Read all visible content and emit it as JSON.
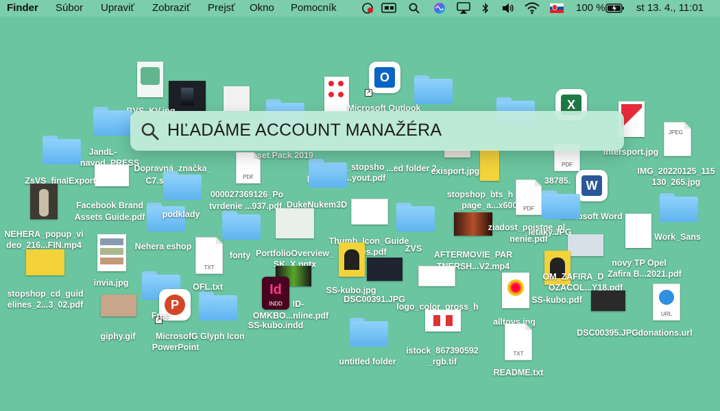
{
  "menubar": {
    "app": "Finder",
    "menus": [
      "Súbor",
      "Upraviť",
      "Zobraziť",
      "Prejsť",
      "Okno",
      "Pomocník"
    ],
    "battery": "100 %",
    "datetime": "st 13. 4.,  11:01",
    "tray_icons": [
      "record-icon",
      "display-icon",
      "search-icon",
      "siri-icon",
      "airplay-icon",
      "bluetooth-icon",
      "volume-icon",
      "wifi-icon",
      "flag-sk-icon",
      "battery-icon"
    ]
  },
  "spotlight": {
    "query": "HĽADÁME ACCOUNT MANAŽÉRA"
  },
  "desktop": {
    "labels": {
      "bvs": "BVS_KV.jpg",
      "outlook": "Microsoft Outlook",
      "jandl": "JandL-",
      "navod": "navod_PRESS",
      "set_pack": "set Pack 2019",
      "zsvs": "ZsVS_finalExport",
      "dopravna1": "Dopravná_značka_",
      "dopravna2": "C7.svg.png",
      "stopshop1_a": "20171205_stopsho",
      "stopshop1_b": "p_cd_gui...yout.pdf",
      "untitled2": "...ed folder 2",
      "intersport": "intersport.jpg",
      "exisport": "exisport.jpg",
      "img_a": "IMG_20220125_115",
      "img_b": "130_265.jpg",
      "po_a": "000027369126_Po",
      "po_b": "tvrdenie ...937.pdf",
      "n38785": "38785.",
      "bts_a": "stopshop_bts_h",
      "bts_b": "_page_a...x600.",
      "fb_a": "Facebook Brand",
      "fb_b": "Assets Guide.pdf",
      "podklady": "podklady",
      "duke": "DukeNukem3D",
      "word": "Microsoft Word",
      "letaky": "letaky.JPG",
      "worksans": "Work_Sans",
      "nehera_a": "NEHERA_popup_vi",
      "nehera_b": "deo_216...FIN.mp4",
      "ziadost_a": "ziadost_poistne_pl",
      "ziadost_b": "nenie.pdf",
      "thumb_a": "Thumb_Icon_Guide",
      "thumb_b": "lines.pdf",
      "nehera_eshop": "Nehera eshop",
      "fonty": "fonty",
      "portfolio_a": "PortfolioOverview_",
      "portfolio_b": "SK_X.pptx",
      "zvs": "ZVS",
      "after_a": "AFTERMOVIE_PAR",
      "after_b": "TNERSH...V2.mp4",
      "opel_a": "novy TP Opel",
      "opel_b": "Zafira B...2021.pdf",
      "invia": "invia.jpg",
      "ofl": "OFL.txt",
      "sskubo_jpg": "SS-kubo.jpg",
      "zafira_a": "OM_ZAFIRA_D",
      "zafira_b": "OZACOL...Y18.pdf",
      "sskubo_pdf": "SS-kubo.pdf",
      "guide_a": "stopshop_cd_guid",
      "guide_b": "elines_2...3_02.pdf",
      "dsc391": "DSC00391.JPG",
      "omkbo_a": "ID-",
      "omkbo_b": "OMKBO...nline.pdf",
      "logo_color": "logo_color_gross_h",
      "free": "Free",
      "sskubo_indd": "SS-kubo.indd",
      "alltoys": "alltoys.jpg",
      "giphy": "giphy.gif",
      "ppt_a": "Microsoft",
      "ppt_b": "PowerPoint",
      "glyph": "IG Glyph Icon",
      "dsc395": "DSC00395.JPG",
      "donations": "donations.url",
      "untitled": "untitled folder",
      "istock_a": "istock_867390592",
      "istock_b": "_rgb.tif",
      "readme": "README.txt",
      "pdf_tag": "PDF",
      "txt_tag": "TXT",
      "jpeg_tag": "JPEG",
      "url_tag": "URL",
      "indd_tag": "INDD"
    }
  },
  "colors": {
    "desktop": "#6bc5a0",
    "folder": "#6fc0f5",
    "outlook": "#0a64c8",
    "word": "#2b579a",
    "excel": "#1d7a45",
    "powerpoint": "#d24726",
    "indesign": "#49021f"
  }
}
